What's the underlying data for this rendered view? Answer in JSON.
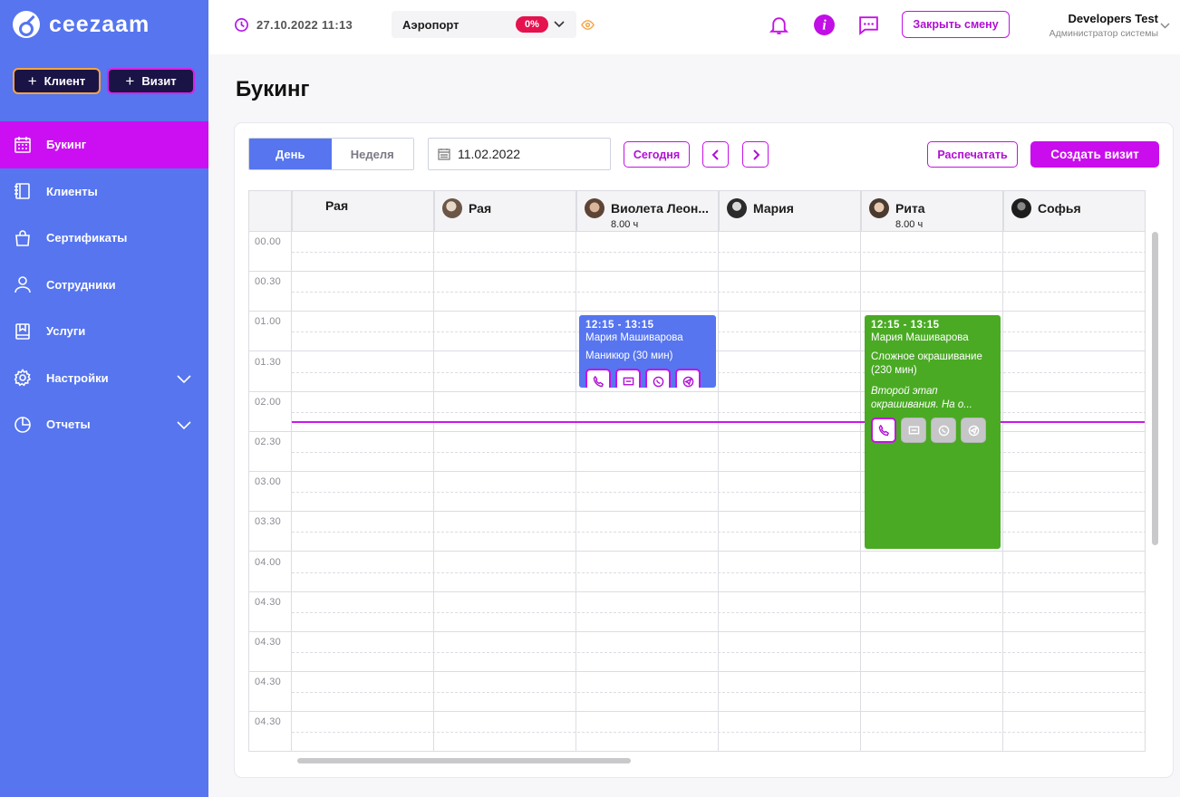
{
  "brand": {
    "name": "ceezaam"
  },
  "quick_actions": {
    "client": "Клиент",
    "visit": "Визит"
  },
  "sidebar": {
    "items": [
      {
        "label": "Букинг",
        "icon": "calendar-icon",
        "active": true
      },
      {
        "label": "Клиенты",
        "icon": "book-icon"
      },
      {
        "label": "Сертификаты",
        "icon": "bag-icon"
      },
      {
        "label": "Сотрудники",
        "icon": "user-icon"
      },
      {
        "label": "Услуги",
        "icon": "bookmark-icon"
      },
      {
        "label": "Настройки",
        "icon": "gear-icon",
        "expandable": true
      },
      {
        "label": "Отчеты",
        "icon": "pie-chart-icon",
        "expandable": true
      }
    ]
  },
  "topbar": {
    "datetime": "27.10.2022 11:13",
    "location": "Аэропорт",
    "location_pct": "0%",
    "close_shift": "Закрыть смену",
    "user_name": "Developers Test",
    "user_role": "Администратор системы"
  },
  "page": {
    "title": "Букинг"
  },
  "toolbar": {
    "view_day": "День",
    "view_week": "Неделя",
    "date": "11.02.2022",
    "today": "Сегодня",
    "print": "Распечатать",
    "create_visit": "Создать визит"
  },
  "staff": [
    {
      "name": "Рая",
      "hours": "",
      "avatar": false
    },
    {
      "name": "Рая",
      "hours": "",
      "avatar": true
    },
    {
      "name": "Виолета Леон...",
      "hours": "8.00 ч",
      "avatar": true
    },
    {
      "name": "Мария",
      "hours": "",
      "avatar": true
    },
    {
      "name": "Рита",
      "hours": "8.00 ч",
      "avatar": true
    },
    {
      "name": "Софья",
      "hours": "",
      "avatar": true
    }
  ],
  "time_slots": [
    "00.00",
    "00.30",
    "01.00",
    "01.30",
    "02.00",
    "02.30",
    "03.00",
    "03.30",
    "04.00",
    "04.30",
    "04.30",
    "04.30",
    "04.30"
  ],
  "appointments": [
    {
      "time": "12:15 - 13:15",
      "client": "Мария Машиварова",
      "service": "Маникюр (30 мин)",
      "note": "",
      "color": "#5675ef"
    },
    {
      "time": "12:15 - 13:15",
      "client": "Мария Машиварова",
      "service": "Сложное окрашивание (230 мин)",
      "note": "Второй этап окрашивания. На о...",
      "color": "#4aaa24"
    }
  ],
  "colors": {
    "sidebar": "#5675ef",
    "accent": "#c90ded",
    "active_nav": "#cc0ff2"
  }
}
